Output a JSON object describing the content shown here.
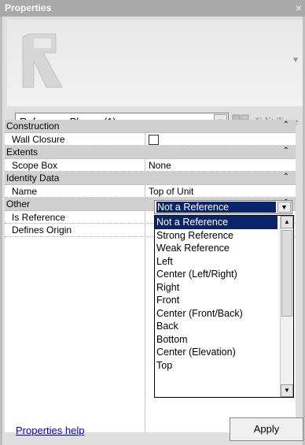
{
  "window": {
    "title": "Properties",
    "close_glyph": "×"
  },
  "preview": {
    "thumbnail_icon": "reference-plane-icon",
    "scroll_glyph": "▼"
  },
  "type_selector": {
    "value": "Reference Planes (1)",
    "dropdown_glyph": "▼"
  },
  "edit_type": {
    "label": "Edit Type",
    "icon": "edit-type-icon"
  },
  "groups": [
    {
      "name": "Construction",
      "collapse_glyph": "⌃",
      "props": [
        {
          "name": "Wall Closure",
          "value": ""
        }
      ]
    },
    {
      "name": "Extents",
      "collapse_glyph": "⌃",
      "props": [
        {
          "name": "Scope Box",
          "value": "None"
        }
      ]
    },
    {
      "name": "Identity Data",
      "collapse_glyph": "⌃",
      "props": [
        {
          "name": "Name",
          "value": "Top of Unit"
        }
      ]
    },
    {
      "name": "Other",
      "collapse_glyph": "⌃",
      "props": [
        {
          "name": "Is Reference",
          "value": ""
        },
        {
          "name": "Defines Origin",
          "value": ""
        }
      ]
    }
  ],
  "is_reference": {
    "selected": "Not a Reference",
    "dropdown_glyph": "▼"
  },
  "reference_options": [
    "Not a Reference",
    "Strong Reference",
    "Weak Reference",
    "Left",
    "Center (Left/Right)",
    "Right",
    "Front",
    "Center (Front/Back)",
    "Back",
    "Bottom",
    "Center (Elevation)",
    "Top"
  ],
  "scrollbar": {
    "up_glyph": "▲",
    "down_glyph": "▼"
  },
  "footer": {
    "help_link": "Properties help",
    "apply_label": "Apply"
  },
  "colors": {
    "selection": "#0a246a",
    "link": "#0000cc",
    "group_header": "#d0d0d0"
  }
}
